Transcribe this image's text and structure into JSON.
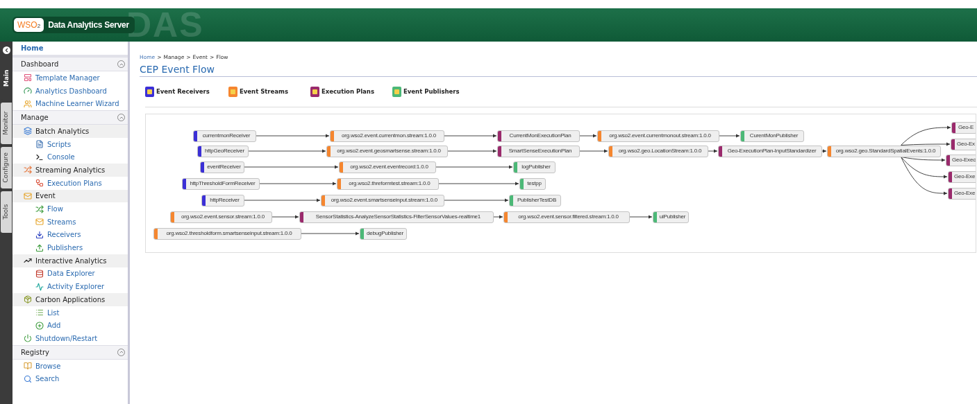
{
  "header": {
    "logo": "WSO",
    "logo_sub": "2",
    "product": "Data Analytics Server",
    "backdrop": "DAS"
  },
  "side_tabs": [
    {
      "label": "Main",
      "selected": true
    },
    {
      "label": "Monitor",
      "selected": false
    },
    {
      "label": "Configure",
      "selected": false
    },
    {
      "label": "Tools",
      "selected": false
    }
  ],
  "sidebar": {
    "home": "Home",
    "sections": [
      {
        "title": "Dashboard",
        "expanded": true,
        "items": [
          {
            "label": "Template Manager"
          },
          {
            "label": "Analytics Dashboard"
          },
          {
            "label": "Machine Learner Wizard"
          }
        ]
      },
      {
        "title": "Manage",
        "expanded": true,
        "items": [
          {
            "label": "Batch Analytics",
            "children": [
              {
                "label": "Scripts"
              },
              {
                "label": "Console"
              }
            ]
          },
          {
            "label": "Streaming Analytics",
            "children": [
              {
                "label": "Execution Plans"
              }
            ]
          },
          {
            "label": "Event",
            "children": [
              {
                "label": "Flow"
              },
              {
                "label": "Streams"
              },
              {
                "label": "Receivers"
              },
              {
                "label": "Publishers"
              }
            ]
          },
          {
            "label": "Interactive Analytics",
            "children": [
              {
                "label": "Data Explorer"
              },
              {
                "label": "Activity Explorer"
              }
            ]
          },
          {
            "label": "Carbon Applications",
            "children": [
              {
                "label": "List"
              },
              {
                "label": "Add"
              }
            ]
          },
          {
            "label": "Shutdown/Restart"
          }
        ]
      },
      {
        "title": "Registry",
        "expanded": true,
        "items": [
          {
            "label": "Browse"
          },
          {
            "label": "Search"
          }
        ]
      }
    ]
  },
  "breadcrumb": {
    "separator": ">",
    "items": [
      "Home",
      "Manage",
      "Event",
      "Flow"
    ]
  },
  "title": "CEP Event Flow",
  "legend": [
    {
      "kind": "receiver",
      "label": "Event Receivers"
    },
    {
      "kind": "stream",
      "label": "Event Streams"
    },
    {
      "kind": "plan",
      "label": "Execution Plans"
    },
    {
      "kind": "publisher",
      "label": "Event Publishers"
    }
  ],
  "flow": {
    "nodes": [
      {
        "kind": "receiver",
        "label": "currentmonReceiver"
      },
      {
        "kind": "stream",
        "label": "org.wso2.event.currentmon.stream:1.0.0"
      },
      {
        "kind": "plan",
        "label": "CurrentMonExecutionPlan"
      },
      {
        "kind": "stream",
        "label": "org.wso2.event.currentmonout.stream:1.0.0"
      },
      {
        "kind": "publisher",
        "label": "CurentMonPublisher"
      },
      {
        "kind": "receiver",
        "label": "httpGeoReceiver"
      },
      {
        "kind": "stream",
        "label": "org.wso2.event.geosmartsense.stream:1.0.0"
      },
      {
        "kind": "plan",
        "label": "SmartSenseExecutionPlan"
      },
      {
        "kind": "stream",
        "label": "org.wso2.geo.LocationStream:1.0.0"
      },
      {
        "kind": "plan",
        "label": "Geo-ExecutionPlan-InputStandardizer"
      },
      {
        "kind": "stream",
        "label": "org.wso2.geo.StandardSpatialEvents:1.0.0"
      },
      {
        "kind": "receiver",
        "label": "eventReceiver"
      },
      {
        "kind": "stream",
        "label": "org.wso2.event.eventrecord:1.0.0"
      },
      {
        "kind": "publisher",
        "label": "logPublisher"
      },
      {
        "kind": "receiver",
        "label": "httpThresholdFormReceiver"
      },
      {
        "kind": "stream",
        "label": "org.wso2.threformtest.stream:1.0.0"
      },
      {
        "kind": "publisher",
        "label": "testpp"
      },
      {
        "kind": "receiver",
        "label": "httpReceiver"
      },
      {
        "kind": "stream",
        "label": "org.wso2.event.smartsenseinput.stream:1.0.0"
      },
      {
        "kind": "publisher",
        "label": "PublisherTestDB"
      },
      {
        "kind": "stream",
        "label": "org.wso2.event.sensor.stream:1.0.0"
      },
      {
        "kind": "plan",
        "label": "SensorStatistics-AnalyzeSensorStatistics-FilterSensorValues-realtime1"
      },
      {
        "kind": "stream",
        "label": "org.wso2.event.sensor.filtered.stream:1.0.0"
      },
      {
        "kind": "publisher",
        "label": "uiPublisher"
      },
      {
        "kind": "stream",
        "label": "org.wso2.thresholdform.smartsenseinput.stream:1.0.0"
      },
      {
        "kind": "publisher",
        "label": "debugPublisher"
      },
      {
        "kind": "plan",
        "label": "Geo-E"
      },
      {
        "kind": "plan",
        "label": "Geo-Ex"
      },
      {
        "kind": "plan",
        "label": "Geo-Exec"
      },
      {
        "kind": "plan",
        "label": "Geo-Exe"
      },
      {
        "kind": "plan",
        "label": "Geo-Exe"
      }
    ]
  }
}
